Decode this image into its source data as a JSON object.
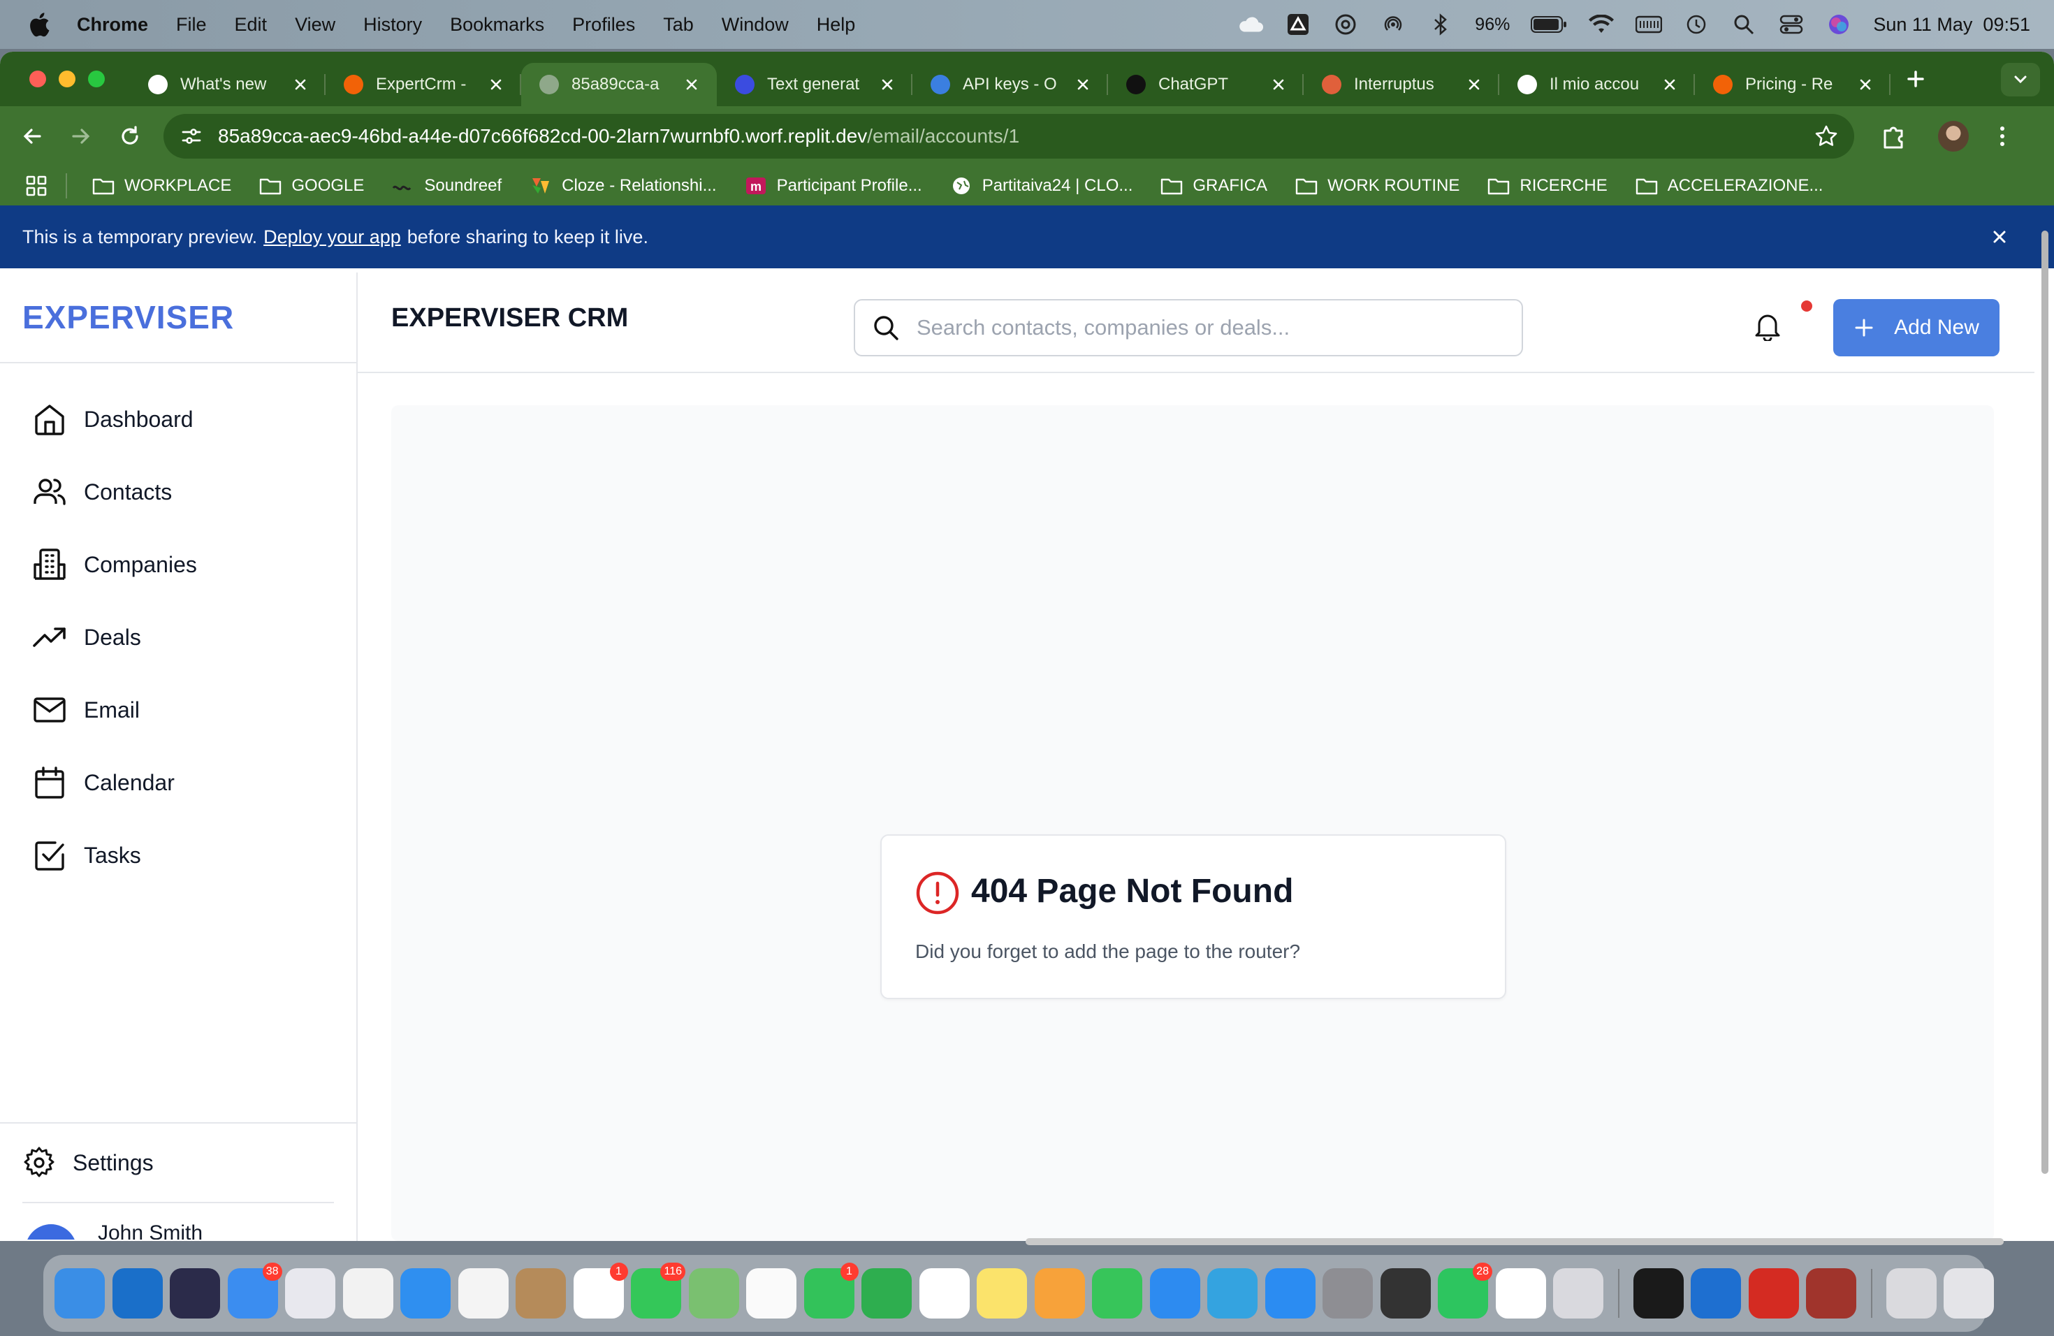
{
  "menubar": {
    "app_name": "Chrome",
    "menus": [
      "File",
      "Edit",
      "View",
      "History",
      "Bookmarks",
      "Profiles",
      "Tab",
      "Window",
      "Help"
    ],
    "battery": "96%",
    "clock": "Sun 11 May  09:51"
  },
  "tabs": [
    {
      "title": "What's new",
      "icon": "chrome-icon",
      "color": "#ffffff"
    },
    {
      "title": "ExpertCrm -",
      "icon": "replit-icon",
      "color": "#f26207"
    },
    {
      "title": "85a89cca-a",
      "icon": "globe-icon",
      "color": "#8fa88a",
      "active": true
    },
    {
      "title": "Text generat",
      "icon": "openai-dev-icon",
      "color": "#3b4ce0"
    },
    {
      "title": "API keys - O",
      "icon": "openai-dev-icon",
      "color": "#3b7fe0"
    },
    {
      "title": "ChatGPT",
      "icon": "chatgpt-icon",
      "color": "#111111"
    },
    {
      "title": "Interruptus",
      "icon": "interruptus-icon",
      "color": "#e0603b"
    },
    {
      "title": "Il mio accou",
      "icon": "account-icon",
      "color": "#ffffff"
    },
    {
      "title": "Pricing - Re",
      "icon": "replit-icon",
      "color": "#f26207"
    }
  ],
  "address": {
    "url_main": "85a89cca-aec9-46bd-a44e-d07c66f682cd-00-2larn7wurnbf0.worf.replit.dev",
    "url_path": "/email/accounts/1"
  },
  "bookmarks": [
    {
      "label": "WORKPLACE",
      "icon": "folder-icon"
    },
    {
      "label": "GOOGLE",
      "icon": "folder-icon"
    },
    {
      "label": "Soundreef",
      "icon": "soundreef-icon"
    },
    {
      "label": "Cloze - Relationshi...",
      "icon": "cloze-icon"
    },
    {
      "label": "Participant Profile...",
      "icon": "m-icon"
    },
    {
      "label": "Partitaiva24 | CLO...",
      "icon": "globe-icon"
    },
    {
      "label": "GRAFICA",
      "icon": "folder-icon"
    },
    {
      "label": "WORK ROUTINE",
      "icon": "folder-icon"
    },
    {
      "label": "RICERCHE",
      "icon": "folder-icon"
    },
    {
      "label": "ACCELERAZIONE...",
      "icon": "folder-icon"
    }
  ],
  "banner": {
    "prefix": "This is a temporary preview.",
    "link": "Deploy your app",
    "suffix": "before sharing to keep it live."
  },
  "app": {
    "brand": "EXPERVISER",
    "page_title": "EXPERVISER CRM",
    "search_placeholder": "Search contacts, companies or deals...",
    "add_new_label": "Add New",
    "nav": [
      {
        "label": "Dashboard",
        "icon": "home-icon"
      },
      {
        "label": "Contacts",
        "icon": "users-icon"
      },
      {
        "label": "Companies",
        "icon": "building-icon"
      },
      {
        "label": "Deals",
        "icon": "trending-up-icon"
      },
      {
        "label": "Email",
        "icon": "mail-icon"
      },
      {
        "label": "Calendar",
        "icon": "calendar-icon"
      },
      {
        "label": "Tasks",
        "icon": "check-square-icon"
      }
    ],
    "settings_label": "Settings",
    "user_name": "John Smith",
    "not_found": {
      "title": "404 Page Not Found",
      "message": "Did you forget to add the page to the router?"
    }
  },
  "dock": [
    {
      "name": "finder",
      "color": "#3a8ee6"
    },
    {
      "name": "outlook",
      "color": "#1a6fc9"
    },
    {
      "name": "siri",
      "color": "#2b2b4a"
    },
    {
      "name": "mail",
      "color": "#3b8df0",
      "badge": "38"
    },
    {
      "name": "launchpad",
      "color": "#e8e8ee"
    },
    {
      "name": "chrome",
      "color": "#f2f2f2"
    },
    {
      "name": "safari",
      "color": "#2f8ff0"
    },
    {
      "name": "opera",
      "color": "#f4f4f4"
    },
    {
      "name": "contacts",
      "color": "#b58b5a"
    },
    {
      "name": "calendar",
      "color": "#ffffff",
      "badge": "1"
    },
    {
      "name": "messages",
      "color": "#34c759",
      "badge": "116"
    },
    {
      "name": "maps",
      "color": "#7ac070"
    },
    {
      "name": "photos",
      "color": "#fafafa"
    },
    {
      "name": "facetime",
      "color": "#33c25a",
      "badge": "1"
    },
    {
      "name": "feedback",
      "color": "#2eae4f"
    },
    {
      "name": "evernote",
      "color": "#ffffff"
    },
    {
      "name": "notes",
      "color": "#fbe36b"
    },
    {
      "name": "pages",
      "color": "#f7a23a"
    },
    {
      "name": "numbers",
      "color": "#37c55a"
    },
    {
      "name": "keynote",
      "color": "#2d8bf0"
    },
    {
      "name": "telegram",
      "color": "#34a3e0"
    },
    {
      "name": "app-store",
      "color": "#2b8cf2"
    },
    {
      "name": "system-settings",
      "color": "#8e8e93"
    },
    {
      "name": "phone",
      "color": "#333333"
    },
    {
      "name": "whatsapp",
      "color": "#2dc55f",
      "badge": "28"
    },
    {
      "name": "chatgpt",
      "color": "#ffffff"
    },
    {
      "name": "iphone-mirroring",
      "color": "#d9d9de"
    },
    {
      "name": "spotify",
      "color": "#1a1a1a"
    },
    {
      "name": "trello",
      "color": "#1e6fd0"
    },
    {
      "name": "acrobat",
      "color": "#d42b22"
    },
    {
      "name": "dictionary",
      "color": "#a0342c"
    },
    {
      "name": "downloads",
      "color": "#dadade"
    },
    {
      "name": "trash",
      "color": "#e4e4e8"
    }
  ]
}
